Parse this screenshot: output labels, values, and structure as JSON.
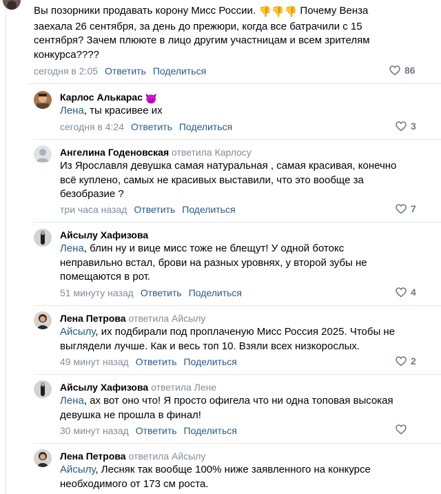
{
  "colors": {
    "link": "#2a5885",
    "secondary": "#818c99",
    "like": "#6f7985",
    "divider": "#e7e8ec"
  },
  "top_comment": {
    "text": "Вы позорники продавать корону Мисс России. 👎👎👎 Почему Венза заехала 26 сентября, за день до прежюри, когда все батрачили с 15 сентября? Зачем плююте в лицо другим участницам и всем зрителям конкурса????",
    "text_l1a": "Вы позорники продавать корону Мисс России.",
    "emoji": "👎👎👎",
    "text_l1b": "Почему Венза",
    "text_l2": "заехала 26 сентября, за день до прежюри, когда все батрачили с 15",
    "text_l3": "сентября? Зачем плююте в лицо другим участницам и всем зрителям",
    "text_l4": "конкурса????",
    "time": "сегодня в 2:05",
    "reply": "Ответить",
    "share": "Поделиться",
    "likes": "86"
  },
  "replies": [
    {
      "author": "Карлос Алькарас",
      "author_emoji": "😈",
      "replied_to": "",
      "mention": "Лена",
      "lines": [
        ", ты красивее их"
      ],
      "time": "сегодня в 4:24",
      "reply": "Ответить",
      "share": "Поделиться",
      "likes": "3"
    },
    {
      "author": "Ангелина Годеновская",
      "replied_to": "ответила Карлосу",
      "mention": "",
      "lines": [
        "Из Ярославля девушка самая натуральная , самая красивая, конечно",
        "всё куплено, самых не красивых выставили, что это вообще за",
        "безобразие ?"
      ],
      "time": "три часа назад",
      "reply": "Ответить",
      "share": "Поделиться",
      "likes": "7"
    },
    {
      "author": "Айсылу Хафизова",
      "replied_to": "",
      "mention": "Лена",
      "lines": [
        ", блин ну и вице мисс тоже не блещут! У одной ботокс",
        "неправильно встал, брови на разных уровнях, у второй зубы не",
        "помещаются в рот."
      ],
      "time": "51 минуту назад",
      "reply": "Ответить",
      "share": "Поделиться",
      "likes": "4"
    },
    {
      "author": "Лена Петрова",
      "replied_to": "ответила Айсылу",
      "mention": "Айсылу",
      "lines": [
        ", их подбирали под проплаченую Мисс Россия 2025. Чтобы не",
        "выглядели лучше. Как и весь топ 10. Взяли всех низкорослых."
      ],
      "time": "49 минут назад",
      "reply": "Ответить",
      "share": "Поделиться",
      "likes": "2"
    },
    {
      "author": "Айсылу Хафизова",
      "replied_to": "ответила Лене",
      "mention": "Лена",
      "lines": [
        ", ах вот оно что! Я просто офигела что ни одна топовая высокая",
        "девушка не прошла в финал!"
      ],
      "time": "30 минут назад",
      "reply": "Ответить",
      "share": "Поделиться",
      "likes": ""
    },
    {
      "author": "Лена Петрова",
      "replied_to": "ответила Айсылу",
      "mention": "Айсылу",
      "lines": [
        ", Лесняк так вообще 100% ниже заявленного на конкурсе",
        "необходимого от 173 см роста."
      ],
      "time": "",
      "reply": "",
      "share": "",
      "likes": ""
    }
  ]
}
